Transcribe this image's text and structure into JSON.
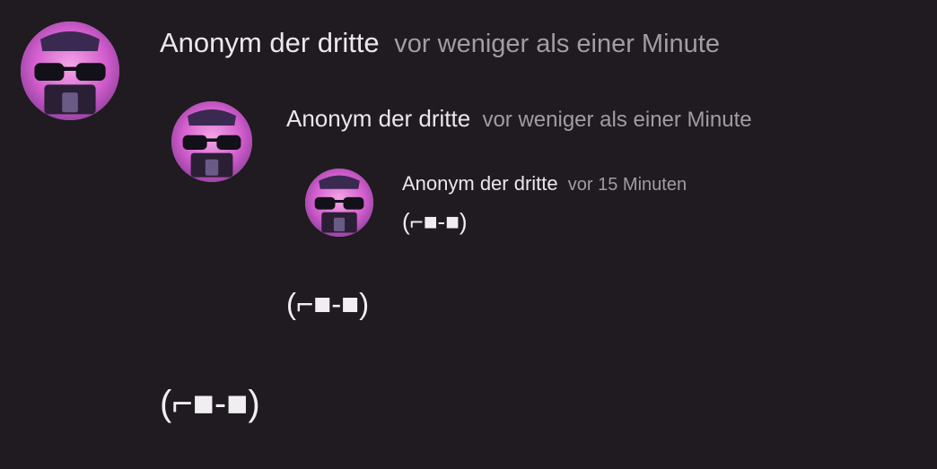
{
  "comments": [
    {
      "author": "Anonym der dritte",
      "time": "vor weniger als einer Minute",
      "text": "(⌐■-■)",
      "avatar_icon": "user-avatar-sunglasses-icon"
    },
    {
      "author": "Anonym der dritte",
      "time": "vor weniger als einer Minute",
      "text": "(⌐■-■)",
      "avatar_icon": "user-avatar-sunglasses-icon"
    },
    {
      "author": "Anonym der dritte",
      "time": "vor 15 Minuten",
      "text": "(⌐■-■)",
      "avatar_icon": "user-avatar-sunglasses-icon"
    }
  ],
  "colors": {
    "background": "#1f1b20",
    "author": "#ebe7ec",
    "time": "#a29ca5",
    "avatar_pink": "#d86fd0"
  }
}
